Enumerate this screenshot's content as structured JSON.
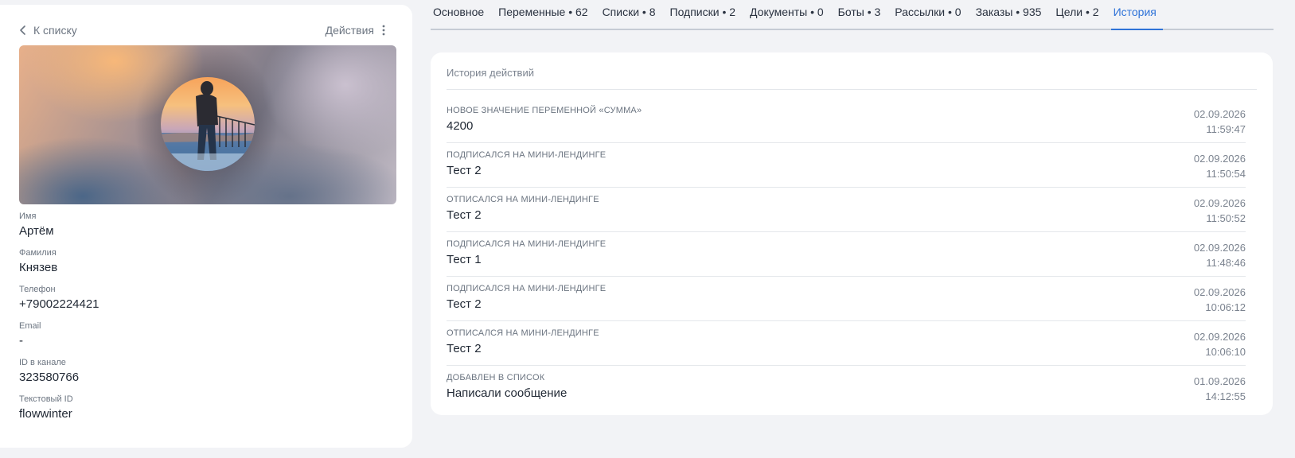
{
  "profile": {
    "back_label": "К списку",
    "actions_label": "Действия",
    "fields": [
      {
        "label": "Имя",
        "value": "Артём"
      },
      {
        "label": "Фамилия",
        "value": "Князев"
      },
      {
        "label": "Телефон",
        "value": "+79002224421"
      },
      {
        "label": "Email",
        "value": "-"
      },
      {
        "label": "ID в канале",
        "value": "323580766"
      },
      {
        "label": "Текстовый ID",
        "value": "flowwinter"
      }
    ]
  },
  "tabs": [
    {
      "label": "Основное",
      "active": false
    },
    {
      "label": "Переменные • 62",
      "active": false
    },
    {
      "label": "Списки • 8",
      "active": false
    },
    {
      "label": "Подписки • 2",
      "active": false
    },
    {
      "label": "Документы • 0",
      "active": false
    },
    {
      "label": "Боты • 3",
      "active": false
    },
    {
      "label": "Рассылки • 0",
      "active": false
    },
    {
      "label": "Заказы • 935",
      "active": false
    },
    {
      "label": "Цели • 2",
      "active": false
    },
    {
      "label": "История",
      "active": true
    }
  ],
  "history": {
    "title": "История действий",
    "items": [
      {
        "label": "НОВОЕ ЗНАЧЕНИЕ ПЕРЕМЕННОЙ «СУММА»",
        "value": "4200",
        "date": "02.09.2026",
        "time": "11:59:47"
      },
      {
        "label": "ПОДПИСАЛСЯ НА МИНИ-ЛЕНДИНГЕ",
        "value": "Тест 2",
        "date": "02.09.2026",
        "time": "11:50:54"
      },
      {
        "label": "ОТПИСАЛСЯ НА МИНИ-ЛЕНДИНГЕ",
        "value": "Тест 2",
        "date": "02.09.2026",
        "time": "11:50:52"
      },
      {
        "label": "ПОДПИСАЛСЯ НА МИНИ-ЛЕНДИНГЕ",
        "value": "Тест 1",
        "date": "02.09.2026",
        "time": "11:48:46"
      },
      {
        "label": "ПОДПИСАЛСЯ НА МИНИ-ЛЕНДИНГЕ",
        "value": "Тест 2",
        "date": "02.09.2026",
        "time": "10:06:12"
      },
      {
        "label": "ОТПИСАЛСЯ НА МИНИ-ЛЕНДИНГЕ",
        "value": "Тест 2",
        "date": "02.09.2026",
        "time": "10:06:10"
      },
      {
        "label": "ДОБАВЛЕН В СПИСОК",
        "value": "Написали сообщение",
        "date": "01.09.2026",
        "time": "14:12:55"
      }
    ]
  },
  "colors": {
    "accent": "#2f73d8",
    "background": "#f2f3f6",
    "card": "#ffffff"
  }
}
